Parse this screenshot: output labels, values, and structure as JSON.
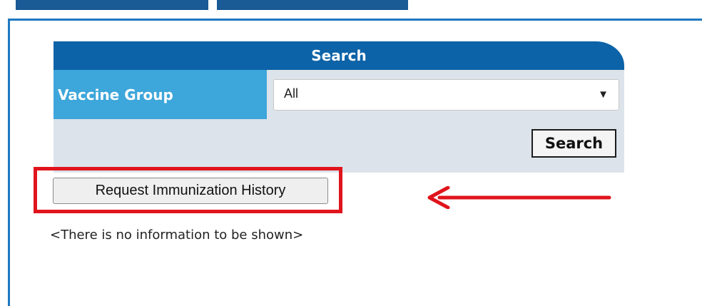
{
  "search_panel": {
    "title": "Search",
    "vaccine_group_label": "Vaccine Group",
    "vaccine_group_value": "All",
    "search_button": "Search"
  },
  "actions": {
    "request_history_button": "Request Immunization History"
  },
  "results": {
    "empty_message": "<There is no information to be shown>"
  },
  "colors": {
    "header": "#0c63a8",
    "label_bg": "#3da6da",
    "highlight": "#e0141c"
  }
}
